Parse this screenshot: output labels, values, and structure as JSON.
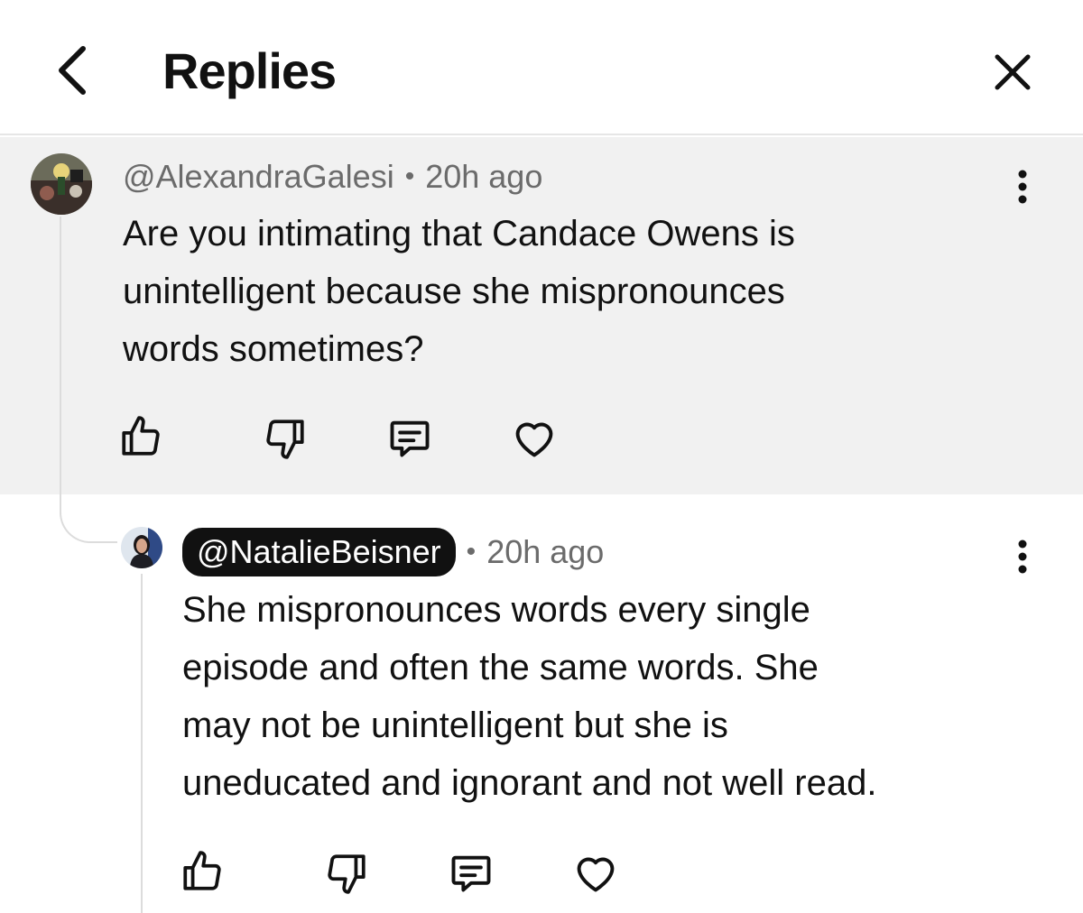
{
  "header": {
    "title": "Replies"
  },
  "parent_comment": {
    "handle": "@AlexandraGalesi",
    "separator": "•",
    "time": "20h ago",
    "lines": [
      "Are you intimating that Candace Owens is",
      "unintelligent because she mispronounces",
      "words sometimes?"
    ]
  },
  "reply_comment": {
    "handle": "@NatalieBeisner",
    "separator": "•",
    "time": "20h ago",
    "lines": [
      "She mispronounces words every single",
      "episode and often the same words. She",
      "may not be unintelligent but she is",
      "uneducated and ignorant and not well read."
    ]
  },
  "icons": {
    "back": "chevron-left-icon",
    "close": "close-icon",
    "more": "more-vertical-icon",
    "like": "thumbs-up-icon",
    "dislike": "thumbs-down-icon",
    "reply": "comment-icon",
    "favorite": "heart-icon"
  },
  "colors": {
    "parent_background": "#f1f1f1",
    "handle_pill": "#111111",
    "meta_text": "#6b6b6b"
  }
}
